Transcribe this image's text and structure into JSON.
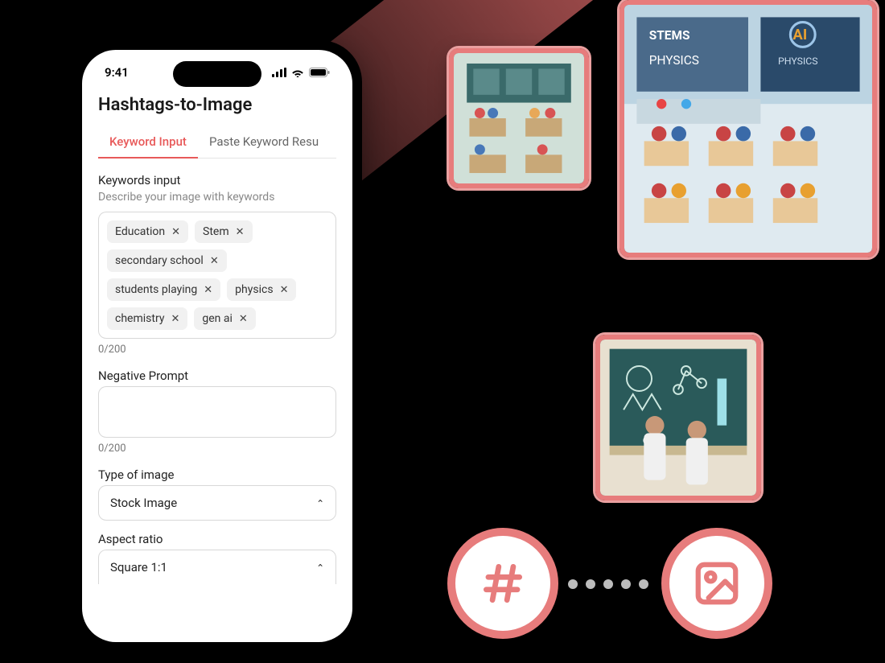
{
  "status": {
    "time": "9:41"
  },
  "page": {
    "title": "Hashtags-to-Image"
  },
  "tabs": [
    {
      "label": "Keyword Input",
      "active": true
    },
    {
      "label": "Paste Keyword Resu",
      "active": false
    }
  ],
  "keywords": {
    "label": "Keywords input",
    "sub": "Describe your image with keywords",
    "chips": [
      "Education",
      "Stem",
      "secondary school",
      "students playing",
      "physics",
      "chemistry",
      "gen ai"
    ],
    "counter": "0/200"
  },
  "negative": {
    "label": "Negative Prompt",
    "counter": "0/200"
  },
  "imageType": {
    "label": "Type of image",
    "value": "Stock Image"
  },
  "aspect": {
    "label": "Aspect ratio",
    "value": "Square 1:1"
  },
  "icons": {
    "hash": "#",
    "image": "image"
  },
  "colors": {
    "accent": "#e85a5a",
    "sample_border": "#e77c7c"
  }
}
